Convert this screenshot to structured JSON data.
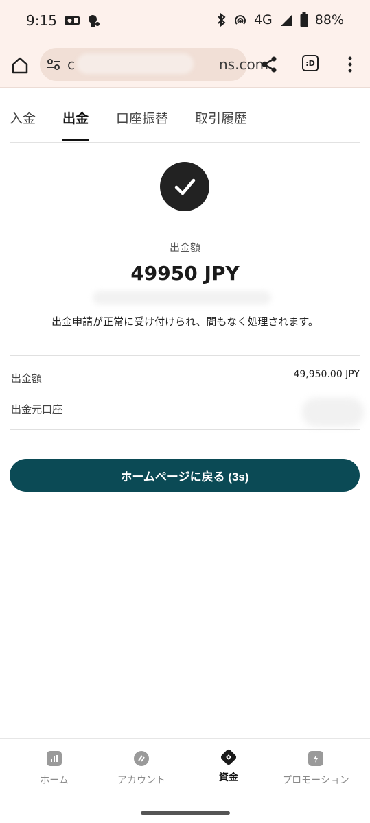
{
  "status_bar": {
    "time": "9:15",
    "network": "4G",
    "battery": "88%",
    "icons": [
      "outlook-icon",
      "android-assistant-icon",
      "bluetooth-icon",
      "hotspot-icon",
      "signal-icon",
      "battery-icon"
    ]
  },
  "browser": {
    "url_visible_fragment": "ns.com",
    "url_prefix": "c",
    "tab_button_label": ":D"
  },
  "tabs": [
    {
      "label": "入金",
      "active": false
    },
    {
      "label": "出金",
      "active": true
    },
    {
      "label": "口座振替",
      "active": false
    },
    {
      "label": "取引履歴",
      "active": false
    }
  ],
  "result": {
    "amount_label": "出金額",
    "amount_big": "49950 JPY",
    "message": "出金申請が正常に受け付けられ、間もなく処理されます。"
  },
  "details": {
    "rows": [
      {
        "label": "出金額",
        "value": "49,950.00 JPY"
      },
      {
        "label": "出金元口座",
        "value": ""
      }
    ]
  },
  "actions": {
    "home_button_label": "ホームページに戻る (3s)"
  },
  "bottom_nav": {
    "items": [
      {
        "label": "ホーム",
        "icon": "chart-icon",
        "active": false
      },
      {
        "label": "アカウント",
        "icon": "account-icon",
        "active": false
      },
      {
        "label": "資金",
        "icon": "funds-icon",
        "active": true
      },
      {
        "label": "プロモーション",
        "icon": "promotion-icon",
        "active": false
      }
    ]
  },
  "colors": {
    "primary_button": "#0b4a55",
    "browser_bar": "#fdf1ec",
    "check_circle": "#222222"
  }
}
